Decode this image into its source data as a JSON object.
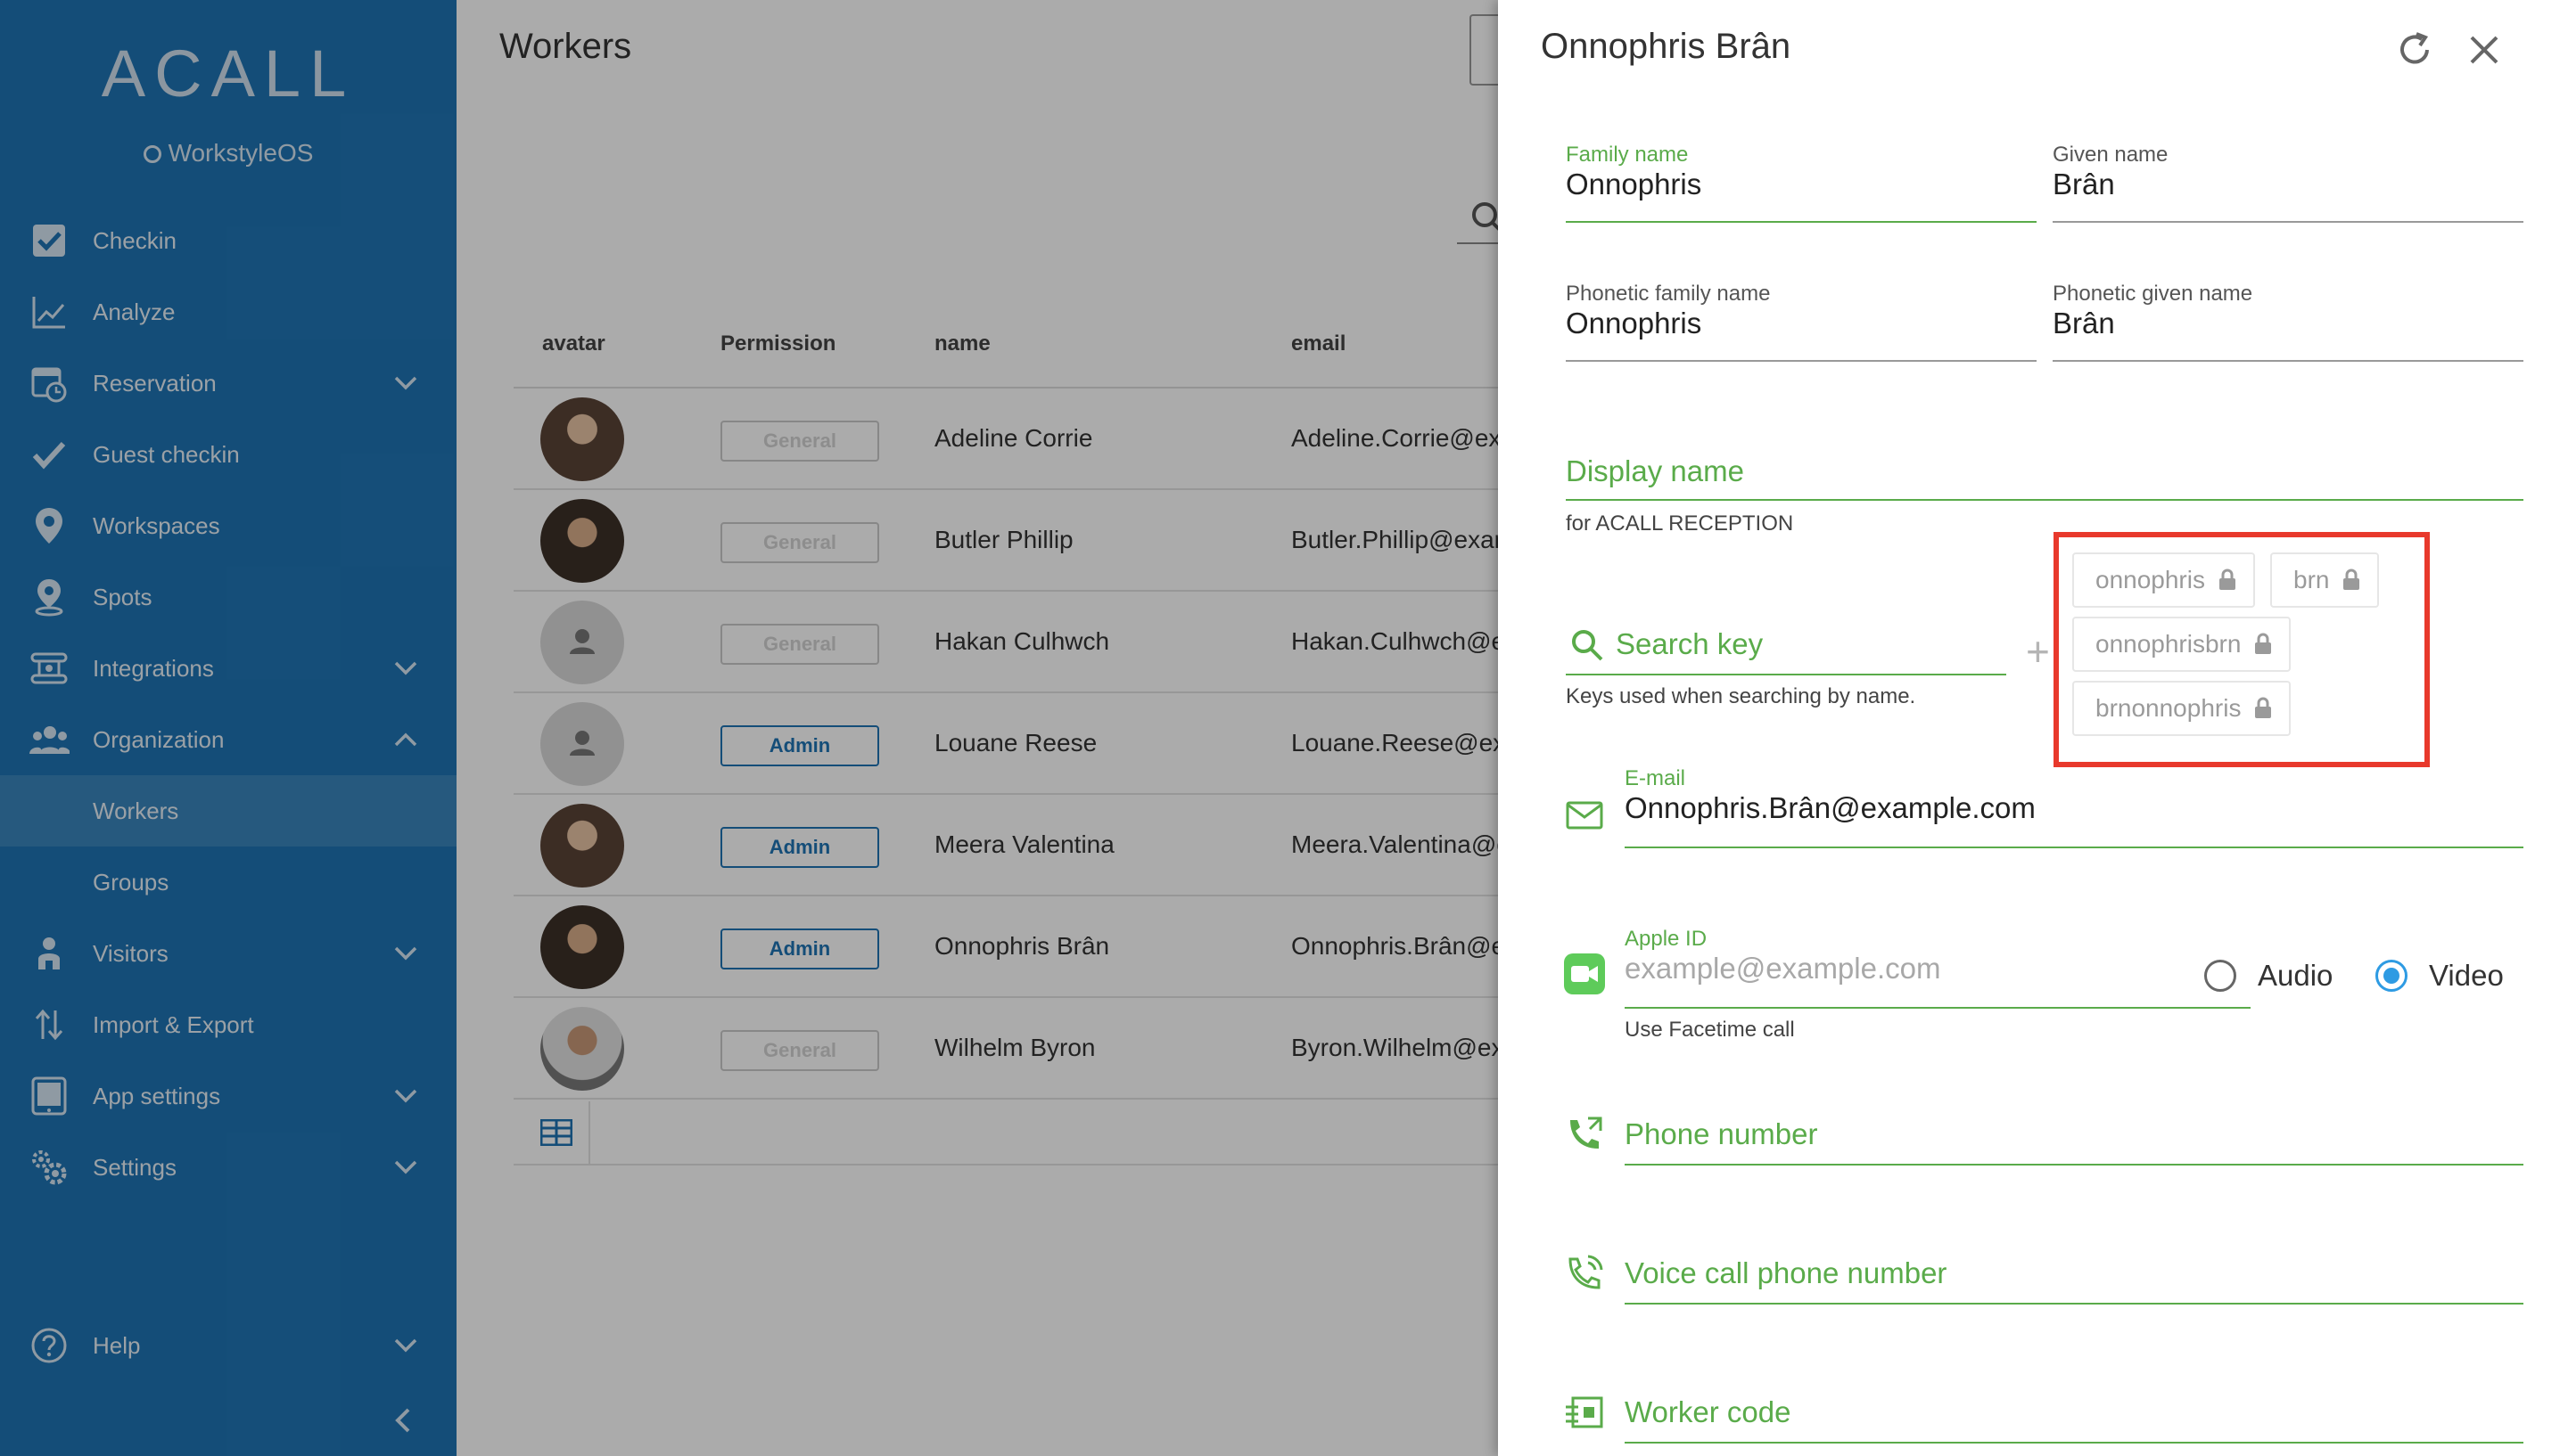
{
  "sidebar": {
    "logo": "ACALL",
    "product": "WorkstyleOS",
    "items": [
      {
        "label": "Checkin",
        "icon": "checkbox-icon"
      },
      {
        "label": "Analyze",
        "icon": "line-chart-icon"
      },
      {
        "label": "Reservation",
        "icon": "calendar-clock-icon",
        "expand": "down"
      },
      {
        "label": "Guest checkin",
        "icon": "check-icon"
      },
      {
        "label": "Workspaces",
        "icon": "location-pin-icon"
      },
      {
        "label": "Spots",
        "icon": "spot-pin-icon"
      },
      {
        "label": "Integrations",
        "icon": "integrations-icon",
        "expand": "down"
      },
      {
        "label": "Organization",
        "icon": "people-icon",
        "expand": "up"
      },
      {
        "label": "Workers",
        "sub": true,
        "active": true
      },
      {
        "label": "Groups",
        "sub": true
      },
      {
        "label": "Visitors",
        "icon": "visitor-icon",
        "expand": "down"
      },
      {
        "label": "Import & Export",
        "icon": "import-export-icon"
      },
      {
        "label": "App settings",
        "icon": "tablet-icon",
        "expand": "down"
      },
      {
        "label": "Settings",
        "icon": "gears-icon",
        "expand": "down"
      },
      {
        "label": "Help",
        "icon": "help-icon",
        "expand": "down"
      }
    ]
  },
  "main": {
    "title": "Workers",
    "columns": [
      "avatar",
      "Permission",
      "name",
      "email"
    ],
    "rows": [
      {
        "permission": "General",
        "name": "Adeline Corrie",
        "email": "Adeline.Corrie@example.com",
        "avatar": "photo"
      },
      {
        "permission": "General",
        "name": "Butler Phillip",
        "email": "Butler.Phillip@example.com",
        "avatar": "photo2"
      },
      {
        "permission": "General",
        "name": "Hakan Culhwch",
        "email": "Hakan.Culhwch@example.com",
        "avatar": "placeholder"
      },
      {
        "permission": "Admin",
        "name": "Louane Reese",
        "email": "Louane.Reese@example.com",
        "avatar": "placeholder"
      },
      {
        "permission": "Admin",
        "name": "Meera Valentina",
        "email": "Meera.Valentina@example.com",
        "avatar": "photo"
      },
      {
        "permission": "Admin",
        "name": "Onnophris Brân",
        "email": "Onnophris.Brân@example.com",
        "avatar": "photo2"
      },
      {
        "permission": "General",
        "name": "Wilhelm Byron",
        "email": "Byron.Wilhelm@example.com",
        "avatar": "photo3"
      }
    ]
  },
  "panel": {
    "title": "Onnophris Brân",
    "family_name": {
      "label": "Family name",
      "value": "Onnophris"
    },
    "given_name": {
      "label": "Given name",
      "value": "Brân"
    },
    "phonetic_family": {
      "label": "Phonetic family name",
      "value": "Onnophris"
    },
    "phonetic_given": {
      "label": "Phonetic given name",
      "value": "Brân"
    },
    "display_name": {
      "placeholder": "Display name",
      "helper": "for ACALL RECEPTION"
    },
    "search_key": {
      "placeholder": "Search key",
      "helper": "Keys used when searching by name.",
      "add": "+"
    },
    "search_keys": [
      "onnophris",
      "brn",
      "onnophrisbrn",
      "brnonnophris"
    ],
    "email": {
      "label": "E-mail",
      "value": "Onnophris.Brân@example.com"
    },
    "apple_id": {
      "label": "Apple ID",
      "placeholder": "example@example.com",
      "helper": "Use Facetime call"
    },
    "call_mode": {
      "options": [
        "Audio",
        "Video"
      ],
      "selected": "Video"
    },
    "phone": {
      "placeholder": "Phone number"
    },
    "voice_phone": {
      "placeholder": "Voice call phone number"
    },
    "worker_code": {
      "placeholder": "Worker code"
    }
  },
  "colors": {
    "sidebar": "#1f74b4",
    "accent_green": "#5aab4a",
    "admin_blue": "#1f74b4",
    "highlight": "#e8392c",
    "radio": "#2e9be3"
  }
}
